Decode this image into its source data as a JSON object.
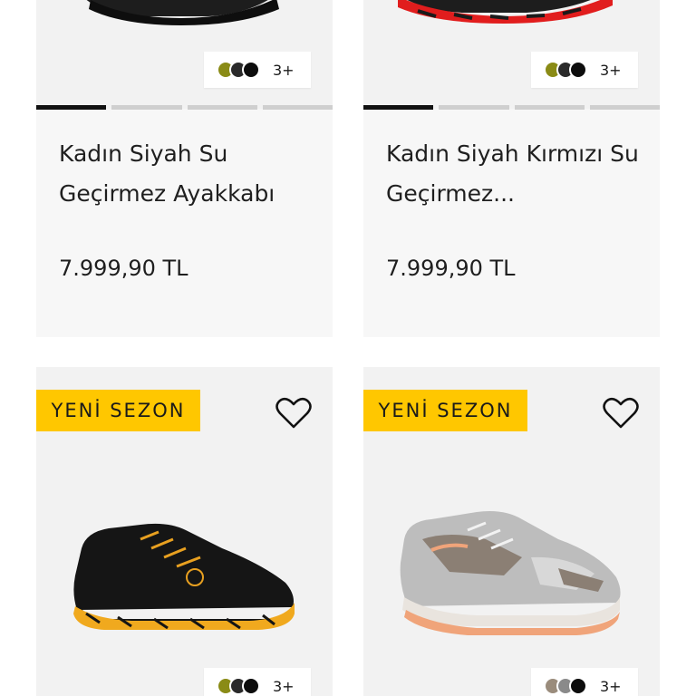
{
  "products": [
    {
      "title": "Kadın Siyah Su Geçirmez Ayakkabı",
      "price": "7.999,90 TL",
      "color_count": "3+",
      "swatches": [
        "#8a8b16",
        "#2a2a2a",
        "#0d0d0d"
      ],
      "image_index": 1,
      "image_total": 4,
      "sole_color": "#1a1a1a"
    },
    {
      "title": "Kadın Siyah Kırmızı Su Geçirmez...",
      "price": "7.999,90 TL",
      "color_count": "3+",
      "swatches": [
        "#8a8b16",
        "#2a2a2a",
        "#0d0d0d"
      ],
      "image_index": 1,
      "image_total": 4,
      "sole_color": "#e02020"
    },
    {
      "badge": "YENİ SEZON",
      "color_count": "3+",
      "swatches": [
        "#8a8b16",
        "#2a2a2a",
        "#0d0d0d"
      ],
      "favorite_icon": "heart-outline-icon"
    },
    {
      "badge": "YENİ SEZON",
      "color_count": "3+",
      "swatches": [
        "#9a8c7c",
        "#8a8a8a",
        "#0d0d0d"
      ],
      "favorite_icon": "heart-outline-icon"
    }
  ],
  "colors": {
    "badge_bg": "#ffc700",
    "progress_active": "#111111",
    "progress_inactive": "#cfcfcf",
    "card_bg": "#f7f7f7"
  }
}
